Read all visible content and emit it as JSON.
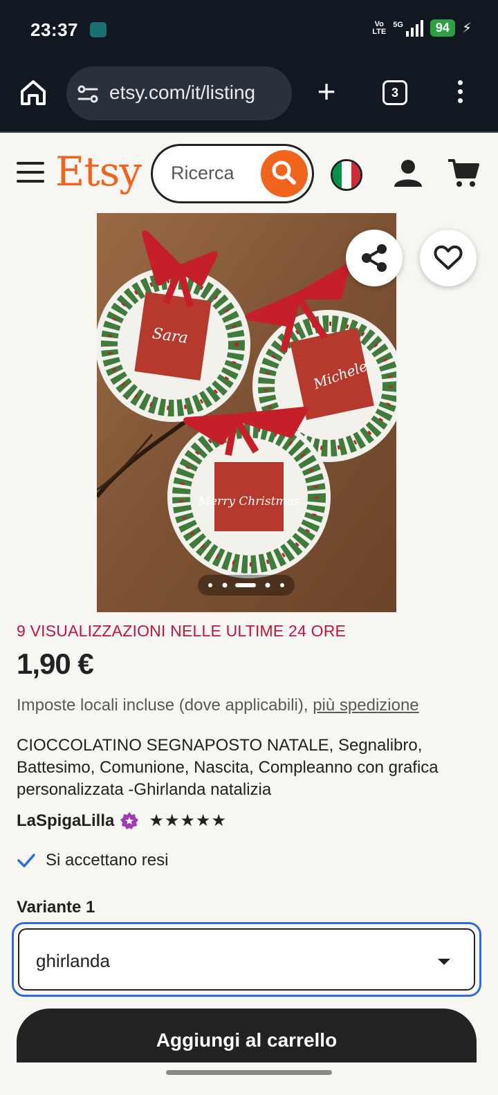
{
  "status_bar": {
    "time": "23:37",
    "network_volte_top": "Vo",
    "network_volte_bottom": "LTE",
    "network_type": "5G",
    "battery_level": "94",
    "icons": [
      "amazon-photos-icon",
      "signal-icon",
      "charging-icon"
    ]
  },
  "browser": {
    "url": "etsy.com/it/listing",
    "tab_count": "3",
    "icons": [
      "home-icon",
      "site-settings-icon",
      "new-tab-icon",
      "tab-switcher-icon",
      "overflow-menu-icon"
    ]
  },
  "etsy_header": {
    "logo": "Etsy",
    "search_placeholder": "Ricerca",
    "flag_colors": [
      "#009246",
      "#ffffff",
      "#ce2b37"
    ],
    "icons": [
      "menu-icon",
      "search-icon",
      "italy-flag-icon",
      "user-icon",
      "cart-icon"
    ]
  },
  "gallery": {
    "image_count": 5,
    "active_index": 2,
    "card_names": [
      "Sara",
      "Michele",
      "Merry Christmas"
    ],
    "icons": [
      "share-icon",
      "heart-icon"
    ]
  },
  "listing": {
    "views_notice": "9 VISUALIZZAZIONI NELLE ULTIME 24 ORE",
    "price": "1,90 €",
    "tax_text": "Imposte locali incluse (dove applicabili), ",
    "shipping_link": "più spedizione",
    "title": "CIOCCOLATINO SEGNAPOSTO NATALE, Segnalibro, Battesimo, Comunione, Nascita, Compleanno con grafica personalizzata -Ghirlanda natalizia",
    "shop_name": "LaSpigaLilla",
    "rating_stars": "★★★★★",
    "rating_value": 5,
    "returns_text": "Si accettano resi",
    "variant_label": "Variante 1",
    "variant_selected": "ghirlanda",
    "add_to_cart_label": "Aggiungi al carrello"
  },
  "colors": {
    "etsy_orange": "#f1641e",
    "urgency_red": "#c3163d",
    "focus_blue": "#2d6be5",
    "dark": "#222222",
    "browser_bg": "#111822",
    "star_seller_purple": "#a13ab6",
    "checkmark_blue": "#2d6be5"
  }
}
